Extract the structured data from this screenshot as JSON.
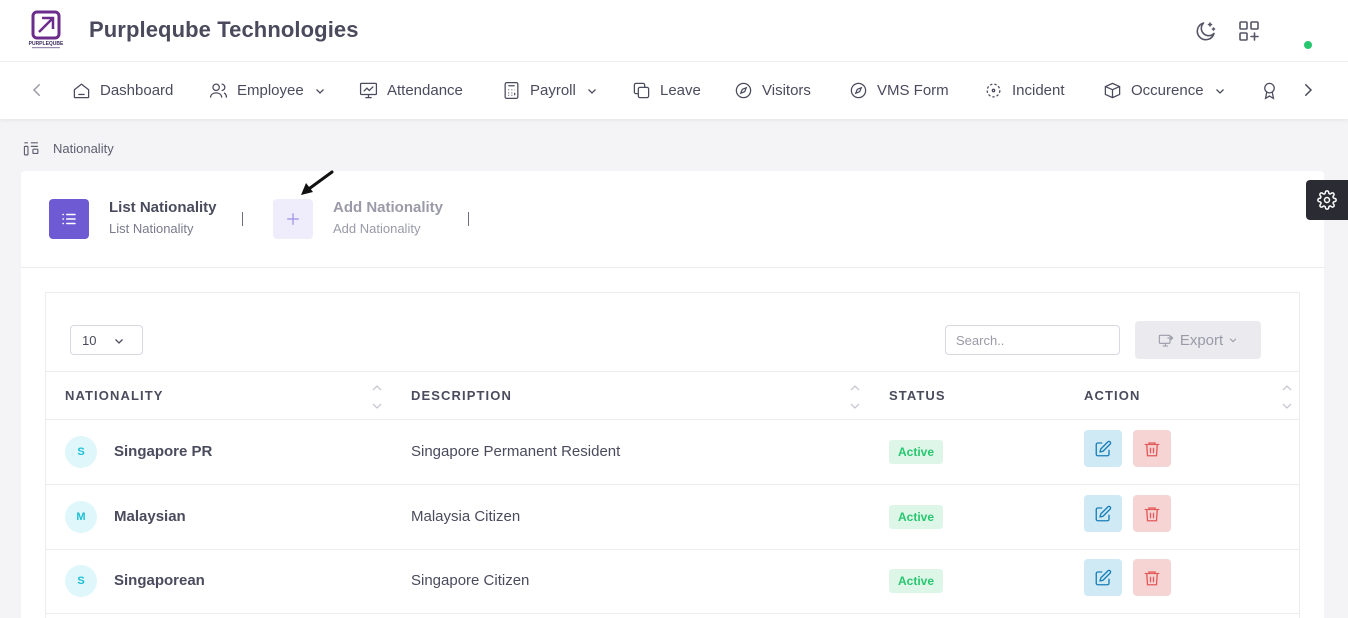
{
  "header": {
    "brand": "Purpleqube Technologies",
    "logo_text": "PURPLEQUBE"
  },
  "nav": {
    "items": [
      {
        "label": "Dashboard",
        "icon": "home-icon"
      },
      {
        "label": "Employee",
        "icon": "users-icon",
        "dropdown": true
      },
      {
        "label": "Attendance",
        "icon": "monitor-icon"
      },
      {
        "label": "Payroll",
        "icon": "calculator-icon",
        "dropdown": true
      },
      {
        "label": "Leave",
        "icon": "copy-icon"
      },
      {
        "label": "Visitors",
        "icon": "compass-icon"
      },
      {
        "label": "VMS Form",
        "icon": "compass-icon"
      },
      {
        "label": "Incident",
        "icon": "focus-icon"
      },
      {
        "label": "Occurence",
        "icon": "package-icon",
        "dropdown": true
      }
    ]
  },
  "breadcrumb": {
    "current": "Nationality"
  },
  "tabs": [
    {
      "title": "List Nationality",
      "subtitle": "List Nationality",
      "active": true
    },
    {
      "title": "Add Nationality",
      "subtitle": "Add Nationality",
      "active": false
    }
  ],
  "table_controls": {
    "page_length": "10",
    "search_placeholder": "Search..",
    "export_label": "Export"
  },
  "table": {
    "columns": [
      "NATIONALITY",
      "DESCRIPTION",
      "STATUS",
      "ACTION"
    ],
    "rows": [
      {
        "initial": "S",
        "nationality": "Singapore PR",
        "description": "Singapore Permanent Resident",
        "status": "Active"
      },
      {
        "initial": "M",
        "nationality": "Malaysian",
        "description": "Malaysia Citizen",
        "status": "Active"
      },
      {
        "initial": "S",
        "nationality": "Singaporean",
        "description": "Singapore Citizen",
        "status": "Active"
      }
    ]
  },
  "colors": {
    "accent": "#6e5bd4",
    "active_green": "#28c76f",
    "edit_blue": "#1a7fb8",
    "delete_red": "#e25b5b"
  }
}
